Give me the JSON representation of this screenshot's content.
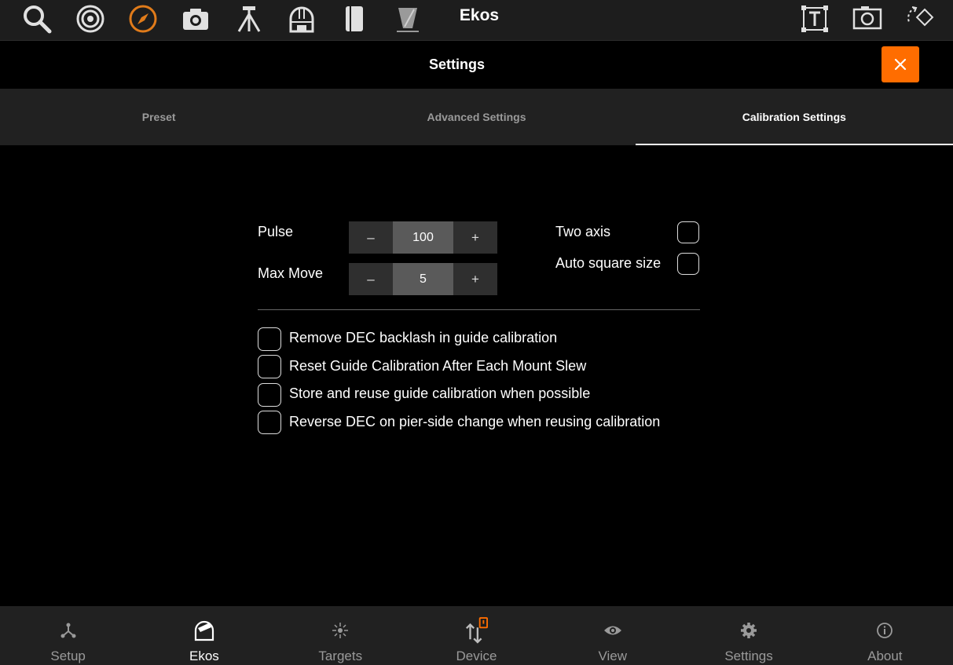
{
  "app": {
    "title": "Ekos",
    "accent_color": "#ff6d00",
    "toolbar_icons": [
      "search-icon",
      "target-icon",
      "compass-icon",
      "camera-icon",
      "tripod-icon",
      "observatory-icon",
      "book-icon",
      "filter-icon"
    ],
    "right_icons": [
      "text-frame-icon",
      "fov-frame-icon",
      "rotate-icon"
    ]
  },
  "settings": {
    "title": "Settings",
    "close_icon": "close-icon"
  },
  "tabs": [
    {
      "label": "Preset",
      "active": false
    },
    {
      "label": "Advanced Settings",
      "active": false
    },
    {
      "label": "Calibration Settings",
      "active": true
    }
  ],
  "calibration": {
    "pulse": {
      "label": "Pulse",
      "value": "100",
      "minus": "–",
      "plus": "+"
    },
    "max_move": {
      "label": "Max Move",
      "value": "5",
      "minus": "–",
      "plus": "+"
    },
    "two_axis": {
      "label": "Two axis",
      "checked": false
    },
    "auto_square": {
      "label": "Auto square size",
      "checked": false
    },
    "options": [
      {
        "label": "Remove DEC backlash in guide calibration",
        "checked": false
      },
      {
        "label": "Reset Guide Calibration After Each Mount Slew",
        "checked": false
      },
      {
        "label": "Store and reuse guide calibration when possible",
        "checked": false
      },
      {
        "label": "Reverse DEC on pier-side change when reusing calibration",
        "checked": false
      }
    ]
  },
  "bottom_nav": [
    {
      "label": "Setup",
      "icon": "setup-icon",
      "active": false
    },
    {
      "label": "Ekos",
      "icon": "ekos-icon",
      "active": true
    },
    {
      "label": "Targets",
      "icon": "targets-icon",
      "active": false
    },
    {
      "label": "Device",
      "icon": "device-icon",
      "active": false
    },
    {
      "label": "View",
      "icon": "eye-icon",
      "active": false
    },
    {
      "label": "Settings",
      "icon": "gear-icon",
      "active": false
    },
    {
      "label": "About",
      "icon": "info-icon",
      "active": false
    }
  ]
}
